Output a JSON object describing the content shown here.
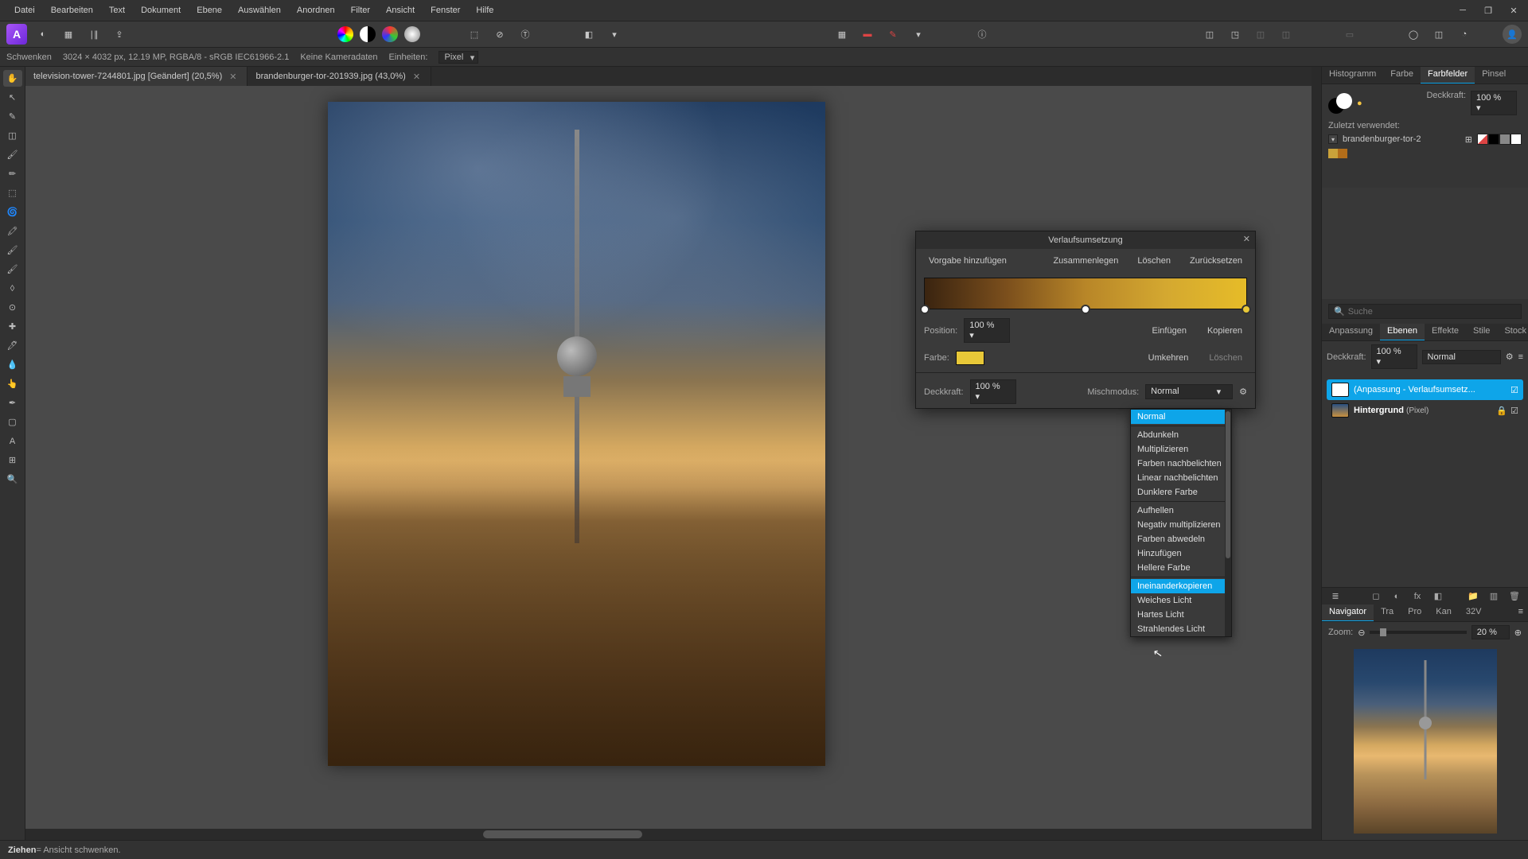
{
  "menu": [
    "Datei",
    "Bearbeiten",
    "Text",
    "Dokument",
    "Ebene",
    "Auswählen",
    "Anordnen",
    "Filter",
    "Ansicht",
    "Fenster",
    "Hilfe"
  ],
  "context": {
    "toolname": "Schwenken",
    "docinfo": "3024 × 4032 px, 12.19 MP, RGBA/8 - sRGB IEC61966-2.1",
    "camera": "Keine Kameradaten",
    "units_label": "Einheiten:",
    "units_value": "Pixel"
  },
  "tabs": [
    {
      "label": "television-tower-7244801.jpg [Geändert] (20,5%)",
      "active": true
    },
    {
      "label": "brandenburger-tor-201939.jpg (43,0%)",
      "active": false
    }
  ],
  "swatches_panel": {
    "tabs": [
      "Histogramm",
      "Farbe",
      "Farbfelder",
      "Pinsel"
    ],
    "active_tab": "Farbfelder",
    "opacity_label": "Deckkraft:",
    "opacity_value": "100 %",
    "recent_label": "Zuletzt verwendet:",
    "preset_name": "brandenburger-tor-2",
    "recent_colors": [
      "#caa23a",
      "#b26d1a"
    ]
  },
  "search_placeholder": "Suche",
  "layer_tabs": [
    "Anpassung",
    "Ebenen",
    "Effekte",
    "Stile",
    "Stock"
  ],
  "layer_active_tab": "Ebenen",
  "layer_opacity_label": "Deckkraft:",
  "layer_opacity_value": "100 %",
  "layer_blend_value": "Normal",
  "layers": [
    {
      "name": "(Anpassung - Verlaufsumsetz...",
      "selected": true,
      "checked": true
    },
    {
      "name": "Hintergrund",
      "type": "(Pixel)",
      "selected": false
    }
  ],
  "nav_tabs": [
    "Navigator",
    "Tra",
    "Pro",
    "Kan",
    "32V"
  ],
  "nav_active": "Navigator",
  "zoom_label": "Zoom:",
  "zoom_value": "20 %",
  "dialog": {
    "title": "Verlaufsumsetzung",
    "buttons": {
      "add": "Vorgabe hinzufügen",
      "merge": "Zusammenlegen",
      "delete": "Löschen",
      "reset": "Zurücksetzen"
    },
    "position_label": "Position:",
    "position_value": "100 %",
    "color_label": "Farbe:",
    "color_value": "#e8c838",
    "insert": "Einfügen",
    "copy": "Kopieren",
    "invert": "Umkehren",
    "del2": "Löschen",
    "op_label": "Deckkraft:",
    "op_value": "100 %",
    "blend_label": "Mischmodus:",
    "blend_value": "Normal",
    "stops": [
      0,
      50,
      100
    ]
  },
  "blend_modes": {
    "groups": [
      [
        "Normal"
      ],
      [
        "Abdunkeln",
        "Multiplizieren",
        "Farben nachbelichten",
        "Linear nachbelichten",
        "Dunklere Farbe"
      ],
      [
        "Aufhellen",
        "Negativ multiplizieren",
        "Farben abwedeln",
        "Hinzufügen",
        "Hellere Farbe"
      ],
      [
        "Ineinanderkopieren",
        "Weiches Licht",
        "Hartes Licht",
        "Strahlendes Licht"
      ]
    ],
    "selected": "Normal",
    "hover": "Ineinanderkopieren"
  },
  "status": {
    "bold": "Ziehen",
    "rest": " = Ansicht schwenken."
  }
}
